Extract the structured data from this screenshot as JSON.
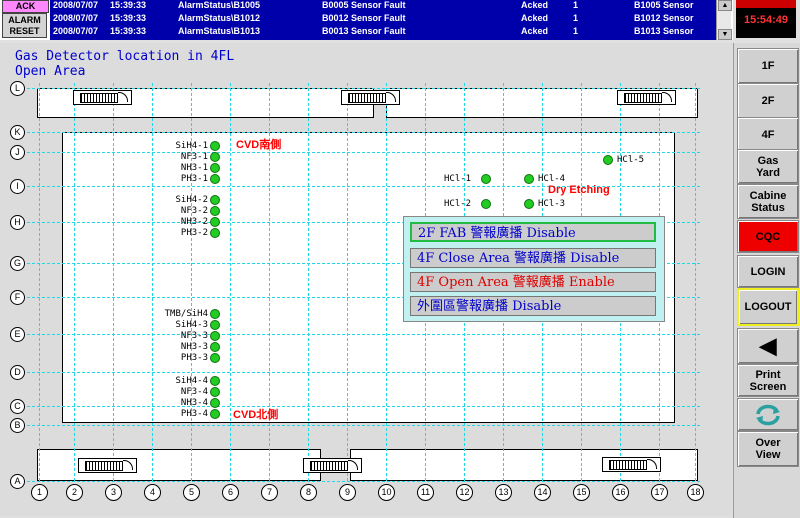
{
  "header": {
    "ack_label": "ACK",
    "reset_label": "ALARM RESET",
    "alarms": [
      {
        "date": "2008/07/07",
        "time": "15:39:33",
        "tag": "AlarmStatus\\B1005",
        "message": "B0005 Sensor Fault",
        "state": "Acked",
        "count": "1",
        "desc": "B1005 Sensor"
      },
      {
        "date": "2008/07/07",
        "time": "15:39:33",
        "tag": "AlarmStatus\\B1012",
        "message": "B0012 Sensor Fault",
        "state": "Acked",
        "count": "1",
        "desc": "B1012 Sensor"
      },
      {
        "date": "2008/07/07",
        "time": "15:39:33",
        "tag": "AlarmStatus\\B1013",
        "message": "B0013 Sensor Fault",
        "state": "Acked",
        "count": "1",
        "desc": "B1013 Sensor"
      }
    ],
    "clock": "15:54:49"
  },
  "map": {
    "title_line1": "Gas Detector location in 4FL",
    "title_line2": "Open Area",
    "row_labels": [
      "L",
      "K",
      "J",
      "I",
      "H",
      "G",
      "F",
      "E",
      "D",
      "C",
      "B",
      "A"
    ],
    "col_labels": [
      "1",
      "2",
      "3",
      "4",
      "5",
      "6",
      "7",
      "8",
      "9",
      "10",
      "11",
      "12",
      "13",
      "14",
      "15",
      "16",
      "17",
      "18"
    ],
    "zone_labels": {
      "cvd_south": "CVD南側",
      "cvd_north": "CVD北側",
      "dry_etching": "Dry Etching"
    },
    "sensors_left": [
      "SiH4-1",
      "NF3-1",
      "NH3-1",
      "PH3-1",
      "SiH4-2",
      "NF3-2",
      "NH3-2",
      "PH3-2",
      "TMB/SiH4",
      "SiH4-3",
      "NF3-3",
      "NH3-3",
      "PH3-3",
      "SiH4-4",
      "NF3-4",
      "NH3-4",
      "PH3-4"
    ],
    "sensors_right": {
      "hcl1": "HCl-1",
      "hcl4": "HCl-4",
      "hcl2": "HCl-2",
      "hcl3": "HCl-3",
      "hcl5": "HCl-5"
    }
  },
  "popup": {
    "items": [
      {
        "label": "2F FAB 警報廣播 Disable",
        "color": "#0000cc"
      },
      {
        "label": "4F Close Area 警報廣播 Disable",
        "color": "#0000cc"
      },
      {
        "label": "4F Open Area 警報廣播 Enable",
        "color": "#dd0000"
      },
      {
        "label": "外圍區警報廣播 Disable",
        "color": "#0000cc"
      }
    ]
  },
  "sidebar": {
    "btn_1f": "1F",
    "btn_2f": "2F",
    "btn_4f": "4F",
    "btn_gas_yard": "Gas Yard",
    "btn_cabine": "Cabine Status",
    "btn_cqc": "CQC",
    "btn_login": "LOGIN",
    "btn_logout": "LOGOUT",
    "btn_print": "Print Screen",
    "btn_overview": "Over View",
    "cqc_color": "#ee0000",
    "logout_border": "#eeee22",
    "refresh_color": "#2aa0a0"
  }
}
